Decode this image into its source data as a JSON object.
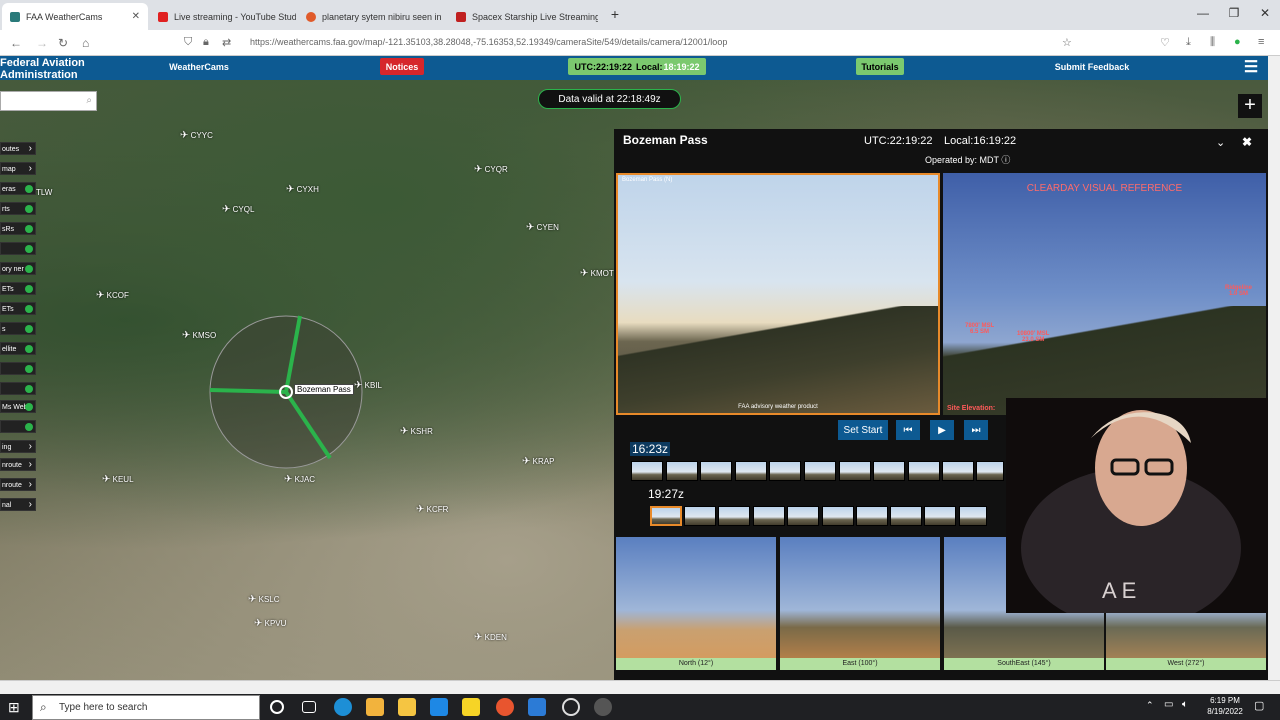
{
  "browser": {
    "tabs": [
      {
        "label": "FAA WeatherCams",
        "color": "#2a7a7a"
      },
      {
        "label": "Live streaming - YouTube Studio",
        "color": "#e02020"
      },
      {
        "label": "planetary sytem nibiru seen in ...",
        "color": "#e05a2a"
      },
      {
        "label": "Spacex Starship Live Streaming",
        "color": "#c02020"
      }
    ],
    "new_tab": "+",
    "url": "https://weathercams.faa.gov/map/-121.35103,38.28048,-75.16353,52.19349/cameraSite/549/details/camera/12001/loop"
  },
  "faa": {
    "title": "Federal Aviation Administration",
    "weathercams_label": "WeatherCams",
    "notices_label": "Notices",
    "utc_label": "UTC:22:19:22",
    "local_prefix": "Local:",
    "local_time": "18:19:22",
    "tutorials_label": "Tutorials",
    "feedback_label": "Submit Feedback",
    "data_valid": "Data valid at 22:18:49z",
    "plus": "+"
  },
  "sidebar": [
    {
      "label": "outes",
      "kind": "a"
    },
    {
      "label": "map",
      "kind": "a"
    },
    {
      "label": "eras",
      "kind": "g"
    },
    {
      "label": "rts",
      "kind": "g"
    },
    {
      "label": "sRs",
      "kind": "g"
    },
    {
      "label": "",
      "kind": "g"
    },
    {
      "label": "ory ner",
      "kind": "g"
    },
    {
      "label": "ETs",
      "kind": "g"
    },
    {
      "label": "ETs",
      "kind": "g"
    },
    {
      "label": "s",
      "kind": "g"
    },
    {
      "label": "ellite",
      "kind": "g"
    },
    {
      "label": "",
      "kind": "g"
    },
    {
      "label": "",
      "kind": "g"
    },
    {
      "label": "Ms Web",
      "kind": "g"
    },
    {
      "label": "",
      "kind": "g"
    },
    {
      "label": "ing",
      "kind": "a"
    },
    {
      "label": "nroute",
      "kind": "a"
    },
    {
      "label": "nroute",
      "kind": "a"
    },
    {
      "label": "nal",
      "kind": "a"
    }
  ],
  "map_pins": [
    "CYYC",
    "CYXH",
    "CYQR",
    "CYQL",
    "CYEN",
    "KMOT",
    "KCOF",
    "KMSO",
    "Bozeman Pass",
    "KBIL",
    "KSHR",
    "KRAP",
    "KEUL",
    "KJAC",
    "KCFR",
    "KSLC",
    "KPVU",
    "KDEN"
  ],
  "map_partial_label": "TLW",
  "panel": {
    "site": "Bozeman Pass",
    "utc": "UTC:22:19:22",
    "local": "Local:16:19:22",
    "operated_by": "Operated by: MDT",
    "cam_overlay_left": "Bozeman Pass (N)",
    "cam_footer": "FAA advisory weather product",
    "clearday": "CLEARDAY VISUAL REFERENCE",
    "ref1": "7800' MSL\n6.5 SM",
    "ref2": "10800' MSL\n23.0 SM",
    "ref3": "Ridgeline\n1.0 SM",
    "site_elevation": "Site Elevation:",
    "set_start": "Set Start",
    "time_start": "16:23z",
    "time_end": "19:27z",
    "views": [
      {
        "label": "North (12°)"
      },
      {
        "label": "East (100°)"
      },
      {
        "label": "SouthEast (145°)"
      },
      {
        "label": "West (272°)"
      }
    ]
  },
  "taskbar": {
    "search_placeholder": "Type here to search",
    "time": "6:19 PM",
    "date": "8/19/2022"
  }
}
